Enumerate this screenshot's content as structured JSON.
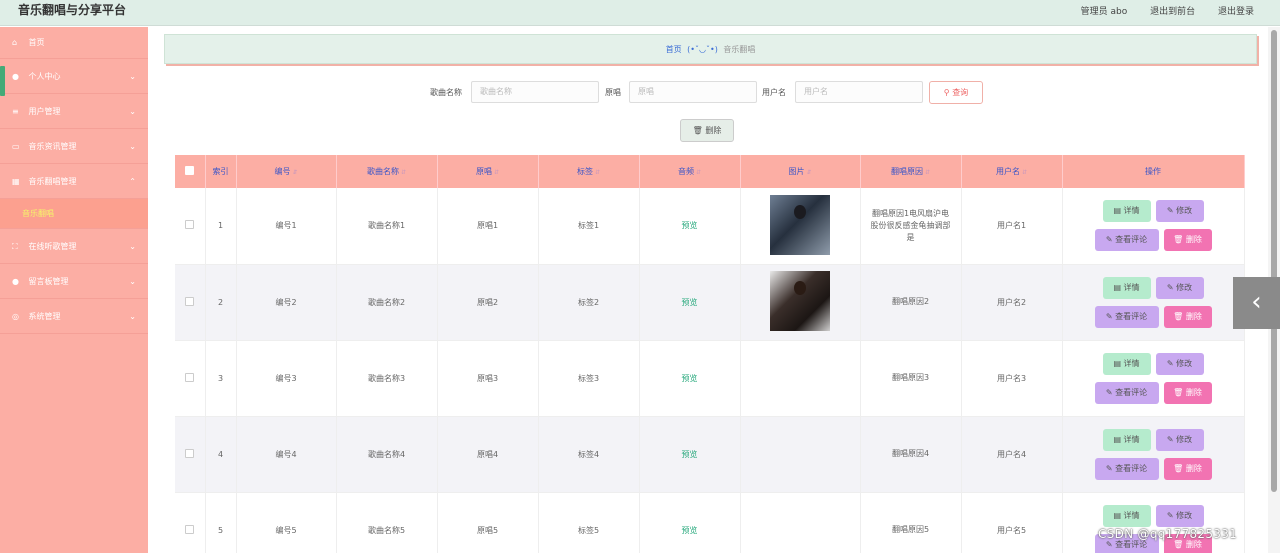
{
  "app": {
    "title": "音乐翻唱与分享平台"
  },
  "topbar": {
    "user": "管理员 abo",
    "front": "退出到前台",
    "logout": "退出登录"
  },
  "sidebar": {
    "items": [
      {
        "icon": "home-icon",
        "glyph": "⌂",
        "label": "首页",
        "chevron": false
      },
      {
        "icon": "user-icon",
        "glyph": "●",
        "label": "个人中心",
        "chevron": true
      },
      {
        "icon": "list-icon",
        "glyph": "≡",
        "label": "用户管理",
        "chevron": true
      },
      {
        "icon": "radio-icon",
        "glyph": "▭",
        "label": "音乐资讯管理",
        "chevron": true
      },
      {
        "icon": "grid-icon",
        "glyph": "▦",
        "label": "音乐翻唱管理",
        "chevron": true,
        "expanded": true
      }
    ],
    "sub": "音乐翻唱",
    "items2": [
      {
        "icon": "scan-icon",
        "glyph": "⛶",
        "label": "在线听歌管理",
        "chevron": true
      },
      {
        "icon": "person-icon",
        "glyph": "●",
        "label": "留言板管理",
        "chevron": true
      },
      {
        "icon": "settings-icon",
        "glyph": "◎",
        "label": "系统管理",
        "chevron": true
      }
    ]
  },
  "breadcrumb": {
    "home": "首页",
    "sep": "(•ˇ◡ˇ•)",
    "current": "音乐翻唱"
  },
  "search": {
    "song_label": "歌曲名称",
    "song_placeholder": "歌曲名称",
    "orig_label": "原唱",
    "orig_placeholder": "原唱",
    "user_label": "用户名",
    "user_placeholder": "用户名",
    "query_button": "查询"
  },
  "delete_button": "删除",
  "table": {
    "headers": {
      "index": "索引",
      "num": "编号",
      "song": "歌曲名称",
      "orig": "原唱",
      "tag": "标签",
      "audio": "音频",
      "img": "图片",
      "reason": "翻唱原因",
      "user": "用户名",
      "ops": "操作"
    },
    "rows": [
      {
        "index": "1",
        "num": "编号1",
        "song": "歌曲名称1",
        "orig": "原唱1",
        "tag": "标签1",
        "audio": "预览",
        "reason": "翻唱原因1电风扇沪电股份很反感金龟抽调部是",
        "user": "用户名1",
        "image": 1
      },
      {
        "index": "2",
        "num": "编号2",
        "song": "歌曲名称2",
        "orig": "原唱2",
        "tag": "标签2",
        "audio": "预览",
        "reason": "翻唱原因2",
        "user": "用户名2",
        "image": 2
      },
      {
        "index": "3",
        "num": "编号3",
        "song": "歌曲名称3",
        "orig": "原唱3",
        "tag": "标签3",
        "audio": "预览",
        "reason": "翻唱原因3",
        "user": "用户名3",
        "image": 0
      },
      {
        "index": "4",
        "num": "编号4",
        "song": "歌曲名称4",
        "orig": "原唱4",
        "tag": "标签4",
        "audio": "预览",
        "reason": "翻唱原因4",
        "user": "用户名4",
        "image": 0
      },
      {
        "index": "5",
        "num": "编号5",
        "song": "歌曲名称5",
        "orig": "原唱5",
        "tag": "标签5",
        "audio": "预览",
        "reason": "翻唱原因5",
        "user": "用户名5",
        "image": 0
      }
    ],
    "ops": {
      "detail": "详情",
      "modify": "修改",
      "review": "查看评论",
      "delete": "删除"
    }
  },
  "watermark": "CSDN @qq177825331",
  "colors": {
    "sidebar": "#fcaea4",
    "topbar": "#dfeee7",
    "header_text": "#3a55c8",
    "detail_btn": "#b5ebcd",
    "modify_btn": "#c8a8f0",
    "delete_btn": "#f273b2"
  }
}
